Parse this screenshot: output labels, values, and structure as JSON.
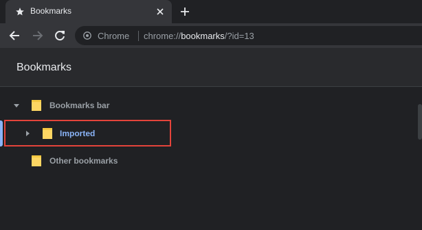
{
  "tab": {
    "title": "Bookmarks"
  },
  "omnibox": {
    "scheme_label": "Chrome",
    "url_prefix": "chrome://",
    "url_host": "bookmarks",
    "url_suffix": "/?id=13"
  },
  "page": {
    "title": "Bookmarks"
  },
  "tree": {
    "items": [
      {
        "label": "Bookmarks bar",
        "expanded": true
      },
      {
        "label": "Imported",
        "expanded": false,
        "selected": true
      },
      {
        "label": "Other bookmarks"
      }
    ]
  },
  "icons": {
    "tab": "star-icon",
    "close": "close-icon",
    "new_tab": "plus-icon",
    "back": "back-arrow-icon",
    "forward": "forward-arrow-icon",
    "reload": "reload-icon",
    "site_info": "chrome-icon",
    "folder": "folder-icon"
  },
  "colors": {
    "background": "#202124",
    "toolbar": "#35363a",
    "selected_text": "#8ab4f8",
    "folder": "#fdd663",
    "highlight_border": "#e5443b"
  }
}
